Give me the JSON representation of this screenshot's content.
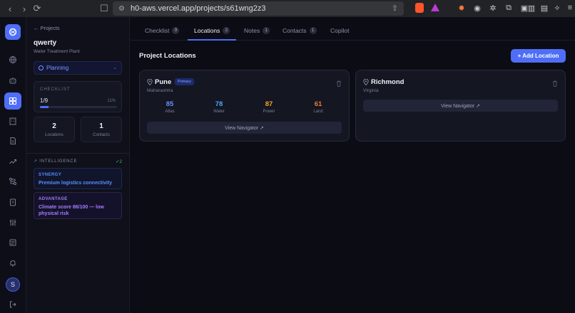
{
  "browser": {
    "url": "h0-aws.vercel.app/projects/s61wng2z3"
  },
  "sidebar": {
    "back_label": "← Projects",
    "project_name": "qwerty",
    "project_type": "Water Treatment Plant",
    "status": "Planning",
    "checklist": {
      "label": "CHECKLIST",
      "count": "1/9",
      "percent_label": "11%",
      "progress": 0.11
    },
    "stats": [
      {
        "value": "2",
        "label": "Locations"
      },
      {
        "value": "1",
        "label": "Contacts"
      }
    ],
    "intelligence": {
      "title": "INTELLIGENCE",
      "count": "✓2",
      "insights": [
        {
          "tag": "SYNERGY",
          "text": "Premium logistics connectivity",
          "color": "#5a8cff"
        },
        {
          "tag": "ADVANTAGE",
          "text": "Climate score 86/100 — low physical risk",
          "color": "#a77bff"
        }
      ]
    },
    "avatar_initial": "S"
  },
  "tabs": [
    {
      "label": "Checklist",
      "badge": "9"
    },
    {
      "label": "Locations",
      "badge": "2"
    },
    {
      "label": "Notes",
      "badge": "1"
    },
    {
      "label": "Contacts",
      "badge": "1"
    },
    {
      "label": "Copilot",
      "badge": ""
    }
  ],
  "main": {
    "title": "Project Locations",
    "add_label": "+ Add Location",
    "locations": [
      {
        "name": "Pune",
        "region": "Maharashtra",
        "badge": "Primary",
        "metrics": [
          {
            "value": "85",
            "label": "Atlas",
            "color": "#6b8cff"
          },
          {
            "value": "78",
            "label": "Water",
            "color": "#4fa3ff"
          },
          {
            "value": "87",
            "label": "Power",
            "color": "#f5a623"
          },
          {
            "value": "61",
            "label": "Land",
            "color": "#f07a32"
          }
        ],
        "view_label": "View Navigator ↗"
      },
      {
        "name": "Richmond",
        "region": "Virginia",
        "badge": "",
        "metrics": [],
        "view_label": "View Navigator ↗"
      }
    ]
  }
}
